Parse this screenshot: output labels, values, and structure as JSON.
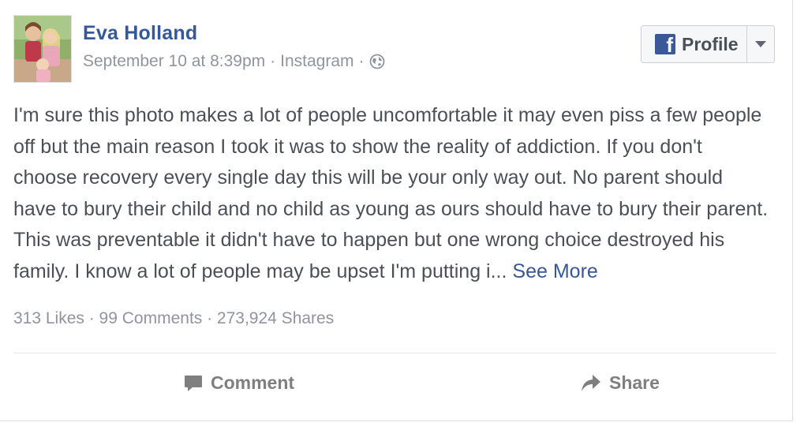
{
  "post": {
    "author": "Eva Holland",
    "date": "September 10 at 8:39pm",
    "source": "Instagram",
    "privacy_icon": "globe-icon",
    "text": "I'm sure this photo makes a lot of people uncomfortable it may even piss a few people off but the main reason I took it was to show the reality of addiction. If you don't choose recovery every single day this will be your only way out. No parent should have to bury their child and no child as young as ours should have to bury their parent. This was preventable it didn't have to happen but one wrong choice destroyed his family. I know a lot of people may be upset I'm putting i...",
    "see_more": "See More",
    "stats": "313 Likes · 99 Comments · 273,924 Shares"
  },
  "header": {
    "profile_button": "Profile",
    "brand_color": "#3b5998",
    "link_color": "#365899"
  },
  "actions": {
    "comment": "Comment",
    "share": "Share"
  },
  "separator": "·"
}
